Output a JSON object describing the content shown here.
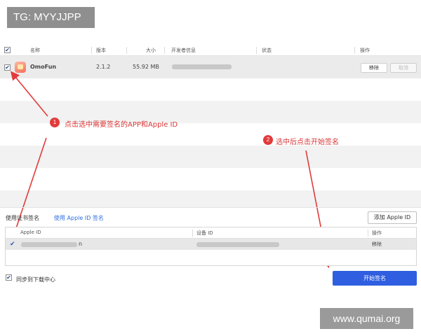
{
  "watermarks": {
    "top_left": "TG: MYYJJPP",
    "bottom_right": "www.qumai.org"
  },
  "app_table": {
    "headers": {
      "name": "名称",
      "version": "版本",
      "size": "大小",
      "developer": "开发者信息",
      "status": "状态",
      "actions": "操作"
    },
    "row": {
      "checked": "✔",
      "name": "OmoFun",
      "version": "2.1.2",
      "size": "55.92 MB",
      "remove": "移除",
      "cancel": "取消"
    }
  },
  "annotations": {
    "step1_number": "1",
    "step1_text": "点击选中需要签名的APP和Apple ID",
    "step2_number": "2",
    "step2_text": "选中后点击开始签名"
  },
  "signing": {
    "tab_certificate": "使用证书签名",
    "tab_apple_id": "使用 Apple ID 签名",
    "add_apple_id": "添加 Apple ID",
    "headers": {
      "apple_id": "Apple ID",
      "device_id": "设备 ID",
      "actions": "操作"
    },
    "row": {
      "checked": "✔",
      "apple_id_suffix": "n",
      "remove": "移除"
    },
    "sync_checked": "✔",
    "sync_label": "同步到下载中心",
    "start_button": "开始签名"
  },
  "colors": {
    "accent": "#2f5fe0",
    "annotation": "#e23b3b"
  }
}
